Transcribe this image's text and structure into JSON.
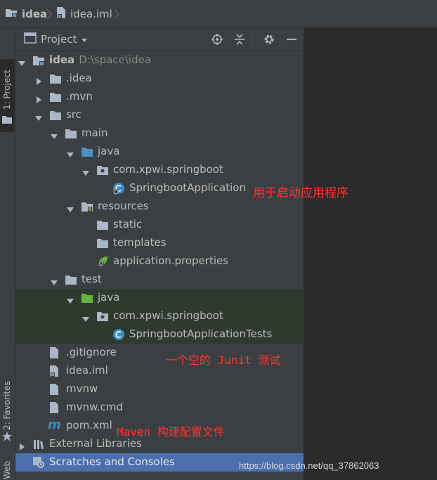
{
  "breadcrumb": {
    "project": "idea",
    "file": "idea.iml"
  },
  "side_strip": {
    "project_tab": "1: Project",
    "favorites_tab": "2: Favorites",
    "web_tab": "Web"
  },
  "panel": {
    "title": "Project"
  },
  "tree": {
    "root_name": "idea",
    "root_path": "D:\\space\\idea",
    "idea_dir": ".idea",
    "mvn_dir": ".mvn",
    "src": "src",
    "main": "main",
    "java_main": "java",
    "package_main": "com.xpwi.springboot",
    "app_class": "SpringbootApplication",
    "resources": "resources",
    "static": "static",
    "templates": "templates",
    "app_props": "application.properties",
    "test": "test",
    "java_test": "java",
    "package_test": "com.xpwi.springboot",
    "test_class": "SpringbootApplicationTests",
    "gitignore": ".gitignore",
    "idea_iml": "idea.iml",
    "mvnw": "mvnw",
    "mvnw_cmd": "mvnw.cmd",
    "pom": "pom.xml",
    "external_libs": "External Libraries",
    "scratches": "Scratches and Consoles"
  },
  "annotations": {
    "app_note": "用于启动应用程序",
    "test_note": "一个空的 Junit 测试",
    "pom_note": "Maven 构建配置文件"
  },
  "watermark": "https://blog.csdn.net/qq_37862063",
  "colors": {
    "annotation": "#ff3333",
    "selection": "#4b6eaf",
    "test_scope": "#2f3a2f",
    "folder": "#a9b7c6",
    "source_folder": "#4a90c8",
    "test_folder": "#62b543"
  }
}
